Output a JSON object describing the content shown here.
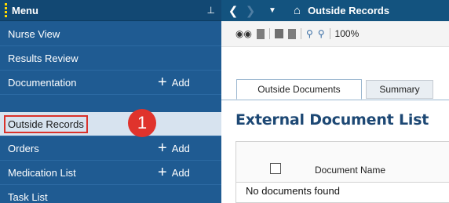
{
  "sidebar": {
    "title": "Menu",
    "items": [
      {
        "label": "Nurse View"
      },
      {
        "label": "Results Review"
      },
      {
        "label": "Documentation",
        "add": "Add"
      },
      {
        "label": "Outside Records"
      },
      {
        "label": "Orders",
        "add": "Add"
      },
      {
        "label": "Medication List",
        "add": "Add"
      },
      {
        "label": "Task List"
      }
    ]
  },
  "callout": {
    "number": "1",
    "color": "#e0332c"
  },
  "topbar": {
    "title": "Outside Records"
  },
  "toolbar": {
    "zoom": "100%"
  },
  "tabs": [
    {
      "label": "Outside Documents"
    },
    {
      "label": "Summary"
    }
  ],
  "main": {
    "section_title": "External Document List",
    "table": {
      "column": "Document Name",
      "empty_message": "No documents found"
    }
  },
  "colors": {
    "sidebar_bg": "#1f5b92",
    "active_bg": "#d7e3ef",
    "highlight": "#d9322b",
    "title": "#1d4874"
  }
}
